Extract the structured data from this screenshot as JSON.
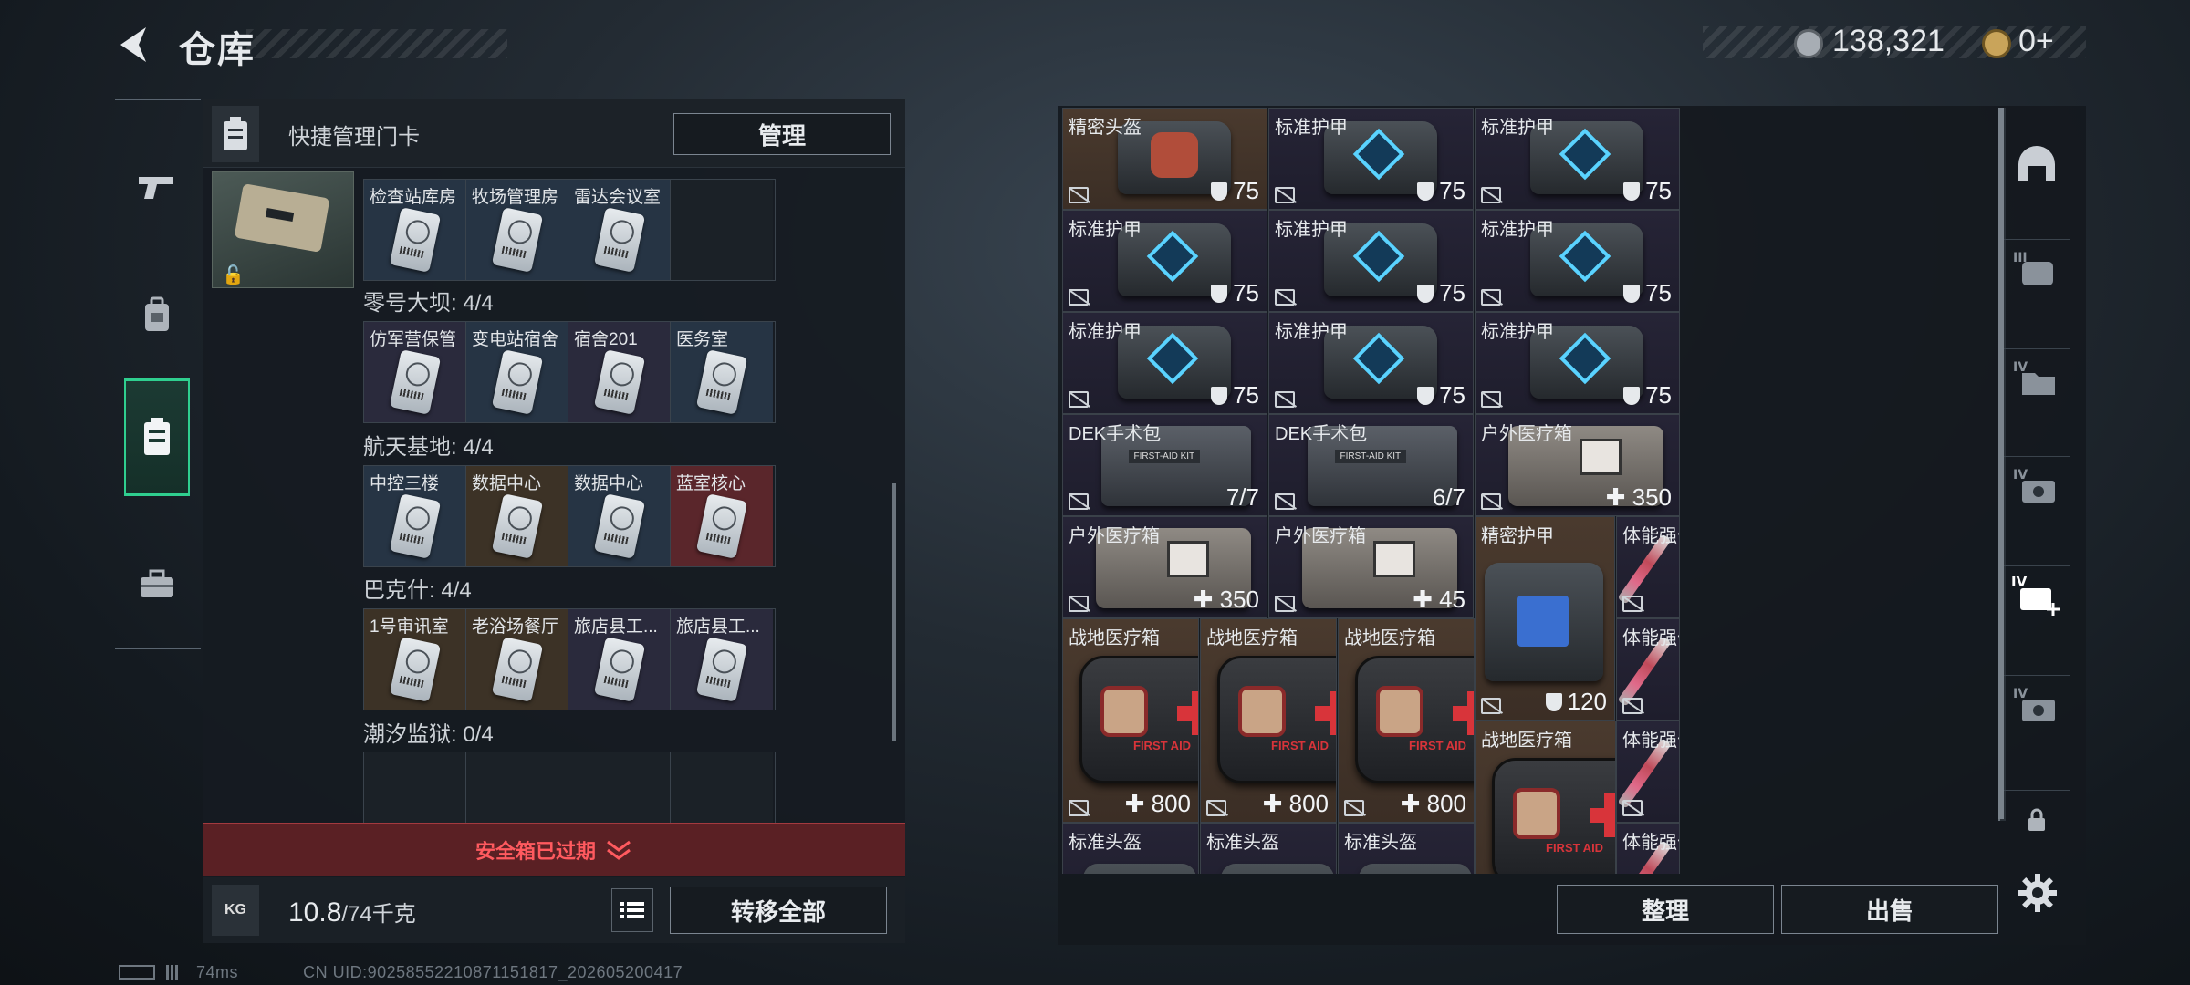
{
  "header": {
    "title": "仓库",
    "currency1": "138,321",
    "currency2": "0+"
  },
  "left_nav": {
    "items": [
      "weapon-tab",
      "backpack-tab",
      "keycard-tab",
      "toolbox-tab"
    ],
    "active": "keycard-tab"
  },
  "left_panel": {
    "title": "快捷管理门卡",
    "manage_label": "管理",
    "sections": [
      {
        "title": "",
        "cards": [
          {
            "name": "检查站库房",
            "bg": "bg-blue"
          },
          {
            "name": "牧场管理房",
            "bg": "bg-blue"
          },
          {
            "name": "雷达会议室",
            "bg": "bg-blue"
          },
          {
            "name": "",
            "bg": "bg-empty"
          }
        ]
      },
      {
        "title": "零号大坝: 4/4",
        "cards": [
          {
            "name": "仿军营保管",
            "bg": "bg-purple"
          },
          {
            "name": "变电站宿舍",
            "bg": "bg-blue"
          },
          {
            "name": "宿舍201",
            "bg": "bg-purple"
          },
          {
            "name": "医务室",
            "bg": "bg-blue"
          }
        ]
      },
      {
        "title": "航天基地: 4/4",
        "cards": [
          {
            "name": "中控三楼",
            "bg": "bg-blue"
          },
          {
            "name": "数据中心",
            "bg": "bg-gold"
          },
          {
            "name": "数据中心",
            "bg": "bg-blue"
          },
          {
            "name": "蓝室核心",
            "bg": "bg-red"
          }
        ]
      },
      {
        "title": "巴克什: 4/4",
        "cards": [
          {
            "name": "1号审讯室",
            "bg": "bg-gold"
          },
          {
            "name": "老浴场餐厅",
            "bg": "bg-gold"
          },
          {
            "name": "旅店县工...",
            "bg": "bg-purple"
          },
          {
            "name": "旅店县工...",
            "bg": "bg-purple"
          }
        ]
      },
      {
        "title": "潮汐监狱: 0/4",
        "cards": [
          {
            "name": "",
            "bg": "bg-empty"
          },
          {
            "name": "",
            "bg": "bg-empty"
          },
          {
            "name": "",
            "bg": "bg-empty"
          },
          {
            "name": "",
            "bg": "bg-empty"
          }
        ]
      }
    ],
    "expired_label": "安全箱已过期",
    "weight_value": "10.8",
    "weight_cap": "/74千克",
    "kg_label": "KG",
    "transfer_label": "转移全部"
  },
  "grid": {
    "items": [
      {
        "name": "精密头盔",
        "value": "75",
        "kind": "shield",
        "art": "vest-pad",
        "color": "c-gold"
      },
      {
        "name": "标准护甲",
        "value": "75",
        "kind": "shield",
        "art": "vest",
        "color": "c-purple"
      },
      {
        "name": "标准护甲",
        "value": "75",
        "kind": "shield",
        "art": "vest",
        "color": "c-purple"
      },
      {
        "name": "标准护甲",
        "value": "75",
        "kind": "shield",
        "art": "vest",
        "color": "c-purple"
      },
      {
        "name": "标准护甲",
        "value": "75",
        "kind": "shield",
        "art": "vest",
        "color": "c-purple"
      },
      {
        "name": "标准护甲",
        "value": "75",
        "kind": "shield",
        "art": "vest",
        "color": "c-purple"
      },
      {
        "name": "标准护甲",
        "value": "75",
        "kind": "shield",
        "art": "vest",
        "color": "c-purple"
      },
      {
        "name": "标准护甲",
        "value": "75",
        "kind": "shield",
        "art": "vest",
        "color": "c-purple"
      },
      {
        "name": "标准护甲",
        "value": "75",
        "kind": "shield",
        "art": "vest",
        "color": "c-purple"
      },
      {
        "name": "DEK手术包",
        "value": "7/7",
        "kind": "plain",
        "art": "pouch",
        "color": "c-purple"
      },
      {
        "name": "DEK手术包",
        "value": "6/7",
        "kind": "plain",
        "art": "pouch",
        "color": "c-purple"
      },
      {
        "name": "户外医疗箱",
        "value": "350",
        "kind": "plus",
        "art": "bag",
        "color": "c-purple"
      },
      {
        "name": "户外医疗箱",
        "value": "350",
        "kind": "plus",
        "art": "bag",
        "color": "c-purple"
      },
      {
        "name": "户外医疗箱",
        "value": "45",
        "kind": "plus",
        "art": "bag",
        "color": "c-purple"
      },
      {
        "name": "精密护甲",
        "value": "120",
        "kind": "shield",
        "art": "vest-scr",
        "color": "c-gold"
      },
      {
        "name": "体能强化剂",
        "value": "",
        "kind": "plain",
        "art": "syringe",
        "color": "c-purple"
      },
      {
        "name": "体能强化剂",
        "value": "",
        "kind": "plain",
        "art": "syringe",
        "color": "c-purple"
      },
      {
        "name": "战地医疗箱",
        "value": "800",
        "kind": "plus",
        "art": "medbox",
        "color": "c-gold"
      },
      {
        "name": "战地医疗箱",
        "value": "800",
        "kind": "plus",
        "art": "medbox",
        "color": "c-gold"
      },
      {
        "name": "战地医疗箱",
        "value": "800",
        "kind": "plus",
        "art": "medbox",
        "color": "c-gold"
      },
      {
        "name": "战地医疗箱",
        "value": "",
        "kind": "plain",
        "art": "medbox",
        "color": "c-gold"
      },
      {
        "name": "体能强化剂",
        "value": "",
        "kind": "plain",
        "art": "syringe",
        "color": "c-purple"
      },
      {
        "name": "标准头盔",
        "value": "",
        "kind": "plain",
        "art": "vest-helm",
        "color": "c-purple"
      },
      {
        "name": "标准头盔",
        "value": "",
        "kind": "plain",
        "art": "vest-helm",
        "color": "c-purple"
      },
      {
        "name": "标准头盔",
        "value": "",
        "kind": "plain",
        "art": "vest-helm",
        "color": "c-purple"
      },
      {
        "name": "体能强化剂",
        "value": "",
        "kind": "plain",
        "art": "syringe",
        "color": "c-purple"
      }
    ],
    "first_aid_label": "FIRST AID"
  },
  "buttons": {
    "sort_label": "整理",
    "sell_label": "出售"
  },
  "right_nav": {
    "items": [
      "helmet-tab",
      "III-armor-tab",
      "IV-folder-tab",
      "IV-camera-tab",
      "IV-add-tab",
      "IV-camera-tab-2",
      "lock-tab"
    ]
  },
  "footer": {
    "ping": "74ms",
    "uid": "CN UID:9025855221087115181​7_202605200417"
  }
}
